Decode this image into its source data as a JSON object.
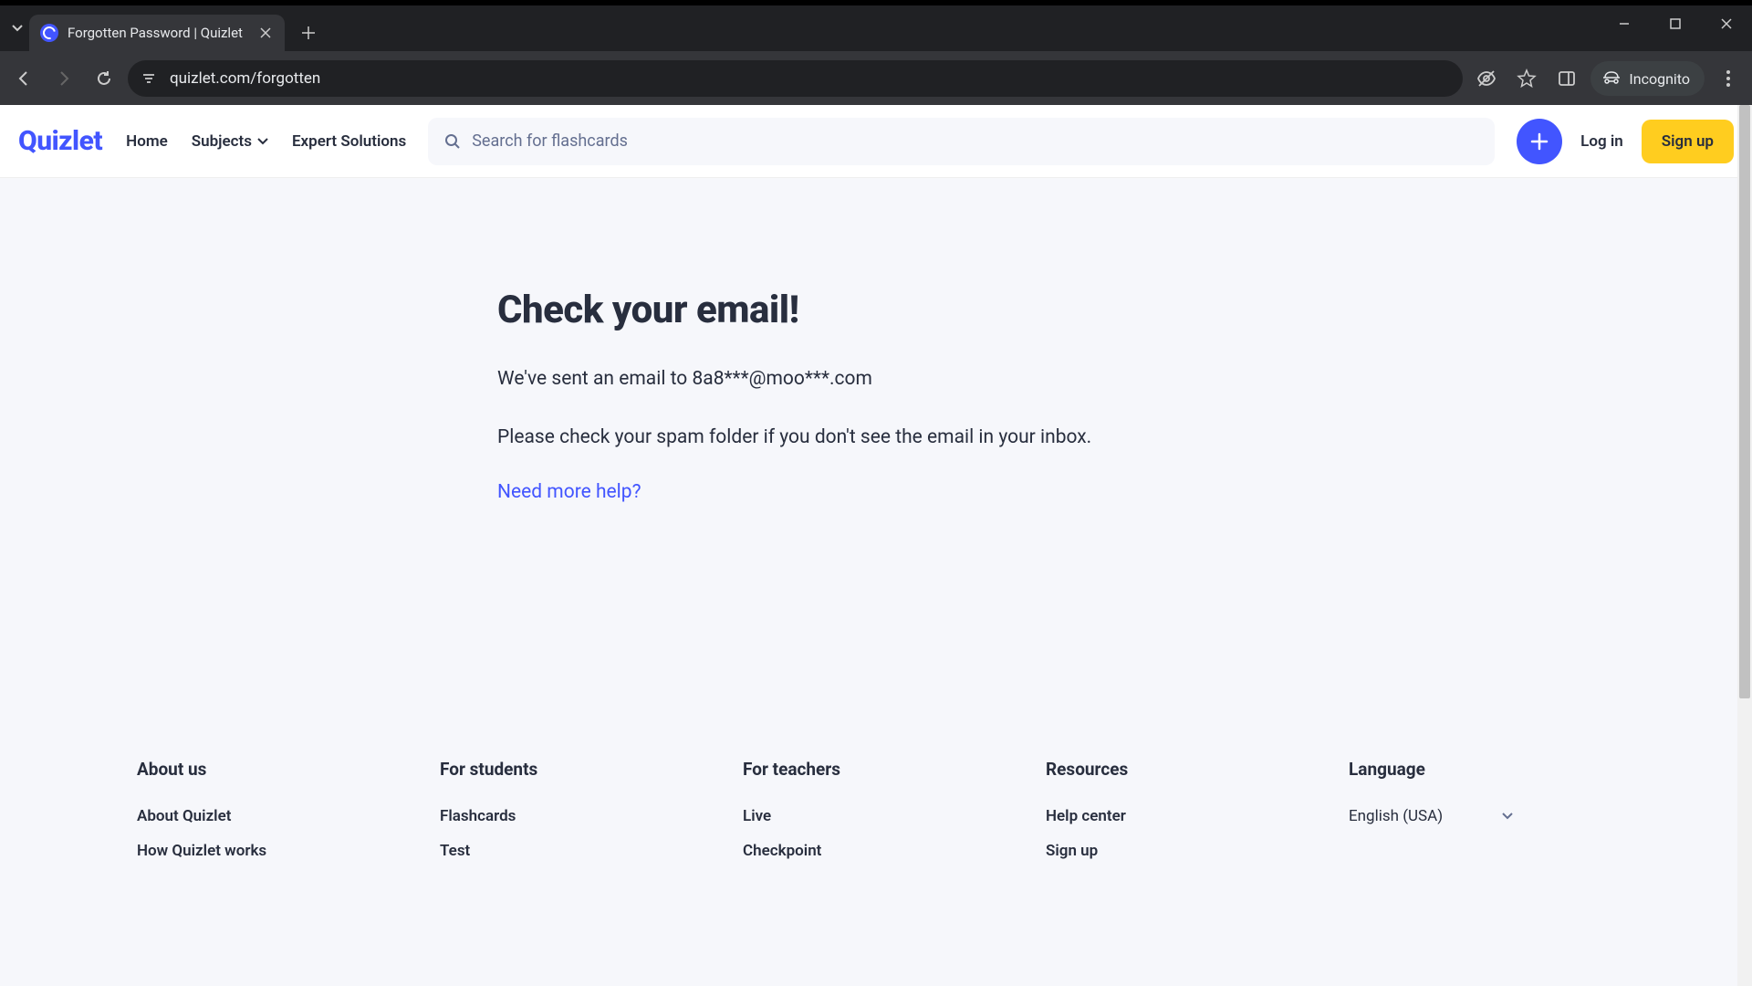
{
  "browser": {
    "tab_title": "Forgotten Password | Quizlet",
    "url": "quizlet.com/forgotten",
    "incognito_label": "Incognito"
  },
  "header": {
    "logo": "Quizlet",
    "nav": {
      "home": "Home",
      "subjects": "Subjects",
      "expert": "Expert Solutions"
    },
    "search_placeholder": "Search for flashcards",
    "login": "Log in",
    "signup": "Sign up"
  },
  "main": {
    "heading": "Check your email!",
    "line1": "We've sent an email to 8a8***@moo***.com",
    "line2": "Please check your spam folder if you don't see the email in your inbox.",
    "help_link": "Need more help?"
  },
  "footer": {
    "about": {
      "title": "About us",
      "links": [
        "About Quizlet",
        "How Quizlet works"
      ]
    },
    "students": {
      "title": "For students",
      "links": [
        "Flashcards",
        "Test"
      ]
    },
    "teachers": {
      "title": "For teachers",
      "links": [
        "Live",
        "Checkpoint"
      ]
    },
    "resources": {
      "title": "Resources",
      "links": [
        "Help center",
        "Sign up"
      ]
    },
    "language": {
      "title": "Language",
      "selected": "English (USA)"
    }
  }
}
